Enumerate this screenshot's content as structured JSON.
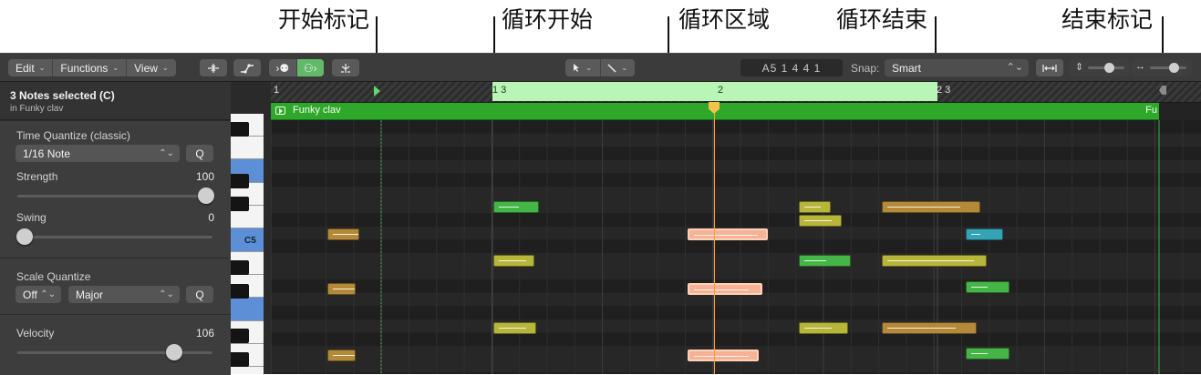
{
  "callouts": {
    "start_marker": "开始标记",
    "cycle_start": "循环开始",
    "cycle_area": "循环区域",
    "cycle_end": "循环结束",
    "end_marker": "结束标记"
  },
  "toolbar": {
    "edit": "Edit",
    "functions": "Functions",
    "view": "View",
    "lcd": "A5  1 4 4 1",
    "snap_label": "Snap:",
    "snap_value": "Smart"
  },
  "inspector": {
    "selection_title": "3 Notes selected (C)",
    "selection_sub": "in Funky clav",
    "time_quantize_label": "Time Quantize (classic)",
    "time_quantize_value": "1/16 Note",
    "q_label": "Q",
    "strength_label": "Strength",
    "strength_value": "100",
    "swing_label": "Swing",
    "swing_value": "0",
    "scale_quantize_label": "Scale Quantize",
    "scale_off": "Off",
    "scale_value": "Major",
    "velocity_label": "Velocity",
    "velocity_value": "106"
  },
  "keyboard": {
    "c5_label": "C5"
  },
  "ruler": {
    "bar1": "1",
    "bar1_3": "1 3",
    "bar2": "2",
    "bar2_3": "2 3"
  },
  "region": {
    "name": "Funky clav",
    "name_trunc": "Fu"
  },
  "colors": {
    "note_yellow": "#b8b63a",
    "note_orange": "#b48a3a",
    "note_green": "#46b547",
    "note_teal": "#34a3b4",
    "note_selected": "#f7b296",
    "cycle": "#b9f5b5",
    "region": "#2fa72a",
    "playhead": "#ff9e2e"
  },
  "icons": {
    "compress": "compress-icon",
    "midi_in": "midi-in-icon",
    "pointer": "pointer-tool-icon",
    "pencil": "pencil-tool-icon",
    "catch": "catch-icon",
    "vertical_zoom": "vertical-zoom-icon",
    "horizontal_zoom": "horizontal-zoom-icon"
  }
}
